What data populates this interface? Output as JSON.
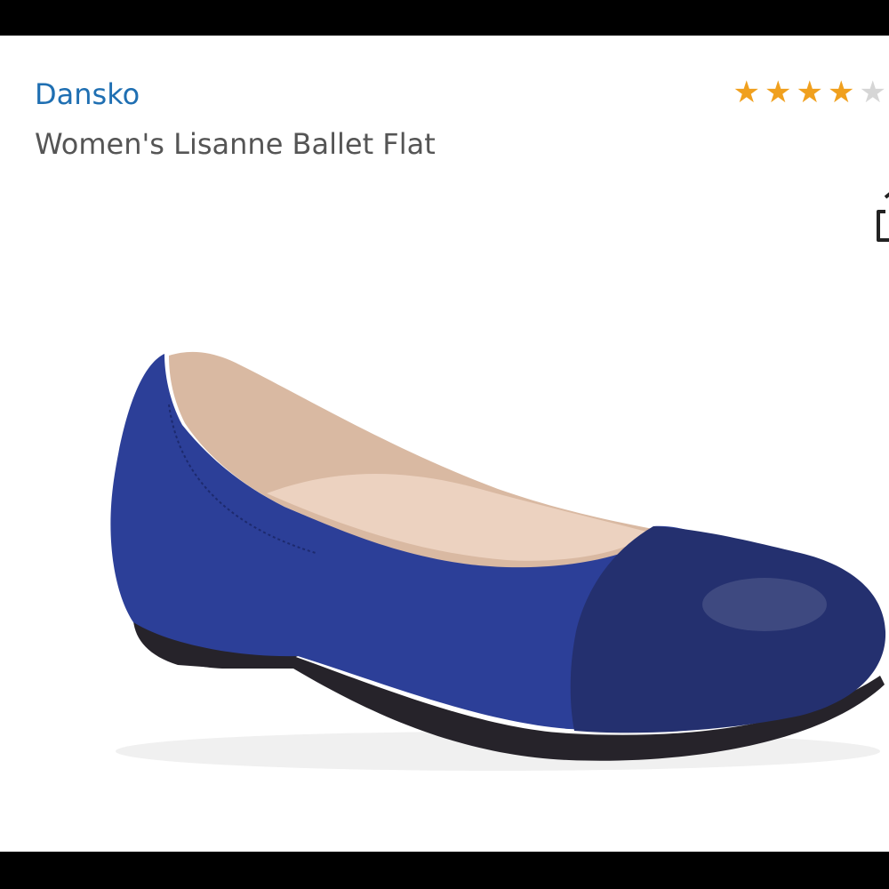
{
  "product": {
    "brand": "Dansko",
    "title": "Women's Lisanne Ballet Flat",
    "rating": 4,
    "rating_max": 5,
    "image": {
      "subject": "ballet-flat-shoe",
      "upper_color": "#2c3f98",
      "toe_cap_color": "#24306f",
      "lining_color": "#d9b9a2",
      "sole_color": "#26232a"
    }
  },
  "colors": {
    "brand_link": "#1f6fb2",
    "star_full": "#f0a01e",
    "star_empty": "#d6d6d6"
  },
  "icons": {
    "share": "share-icon",
    "star": "star-icon"
  }
}
